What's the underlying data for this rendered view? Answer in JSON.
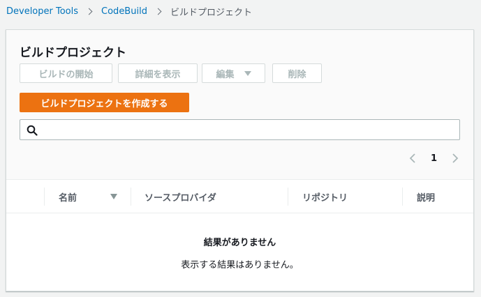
{
  "breadcrumb": {
    "items": [
      {
        "label": "Developer Tools"
      },
      {
        "label": "CodeBuild"
      },
      {
        "label": "ビルドプロジェクト"
      }
    ]
  },
  "panel": {
    "title": "ビルドプロジェクト",
    "buttons": {
      "start_build": "ビルドの開始",
      "view_details": "詳細を表示",
      "edit": "編集",
      "delete": "削除",
      "create_project": "ビルドプロジェクトを作成する"
    },
    "search": {
      "value": "",
      "placeholder": ""
    },
    "pagination": {
      "current_page": "1"
    }
  },
  "table": {
    "columns": [
      "名前",
      "ソースプロバイダ",
      "リポジトリ",
      "説明"
    ],
    "empty_title": "結果がありません",
    "empty_description": "表示する結果はありません。"
  },
  "colors": {
    "accent": "#ec7211",
    "link": "#0073bb",
    "disabled_text": "#aab7b8",
    "page_background": "#f2f3f3"
  },
  "icons": [
    "chevron-right-icon",
    "search-icon",
    "caret-down-icon",
    "chevron-left-icon",
    "sort-descending-icon"
  ]
}
